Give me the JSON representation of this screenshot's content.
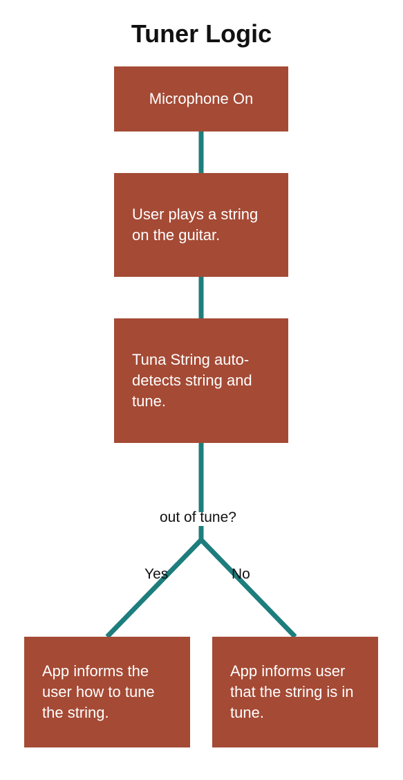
{
  "title": "Tuner Logic",
  "nodes": {
    "n1": "Microphone On",
    "n2": "User plays a string on the guitar.",
    "n3": "Tuna String auto-detects string and tune.",
    "yes": "App informs the user how to tune the string.",
    "no": "App informs user that the string is in tune."
  },
  "decision": {
    "question": "out of tune?",
    "yes_label": "Yes",
    "no_label": "No"
  },
  "colors": {
    "box": "#a54a35",
    "connector": "#1e7d7d"
  }
}
